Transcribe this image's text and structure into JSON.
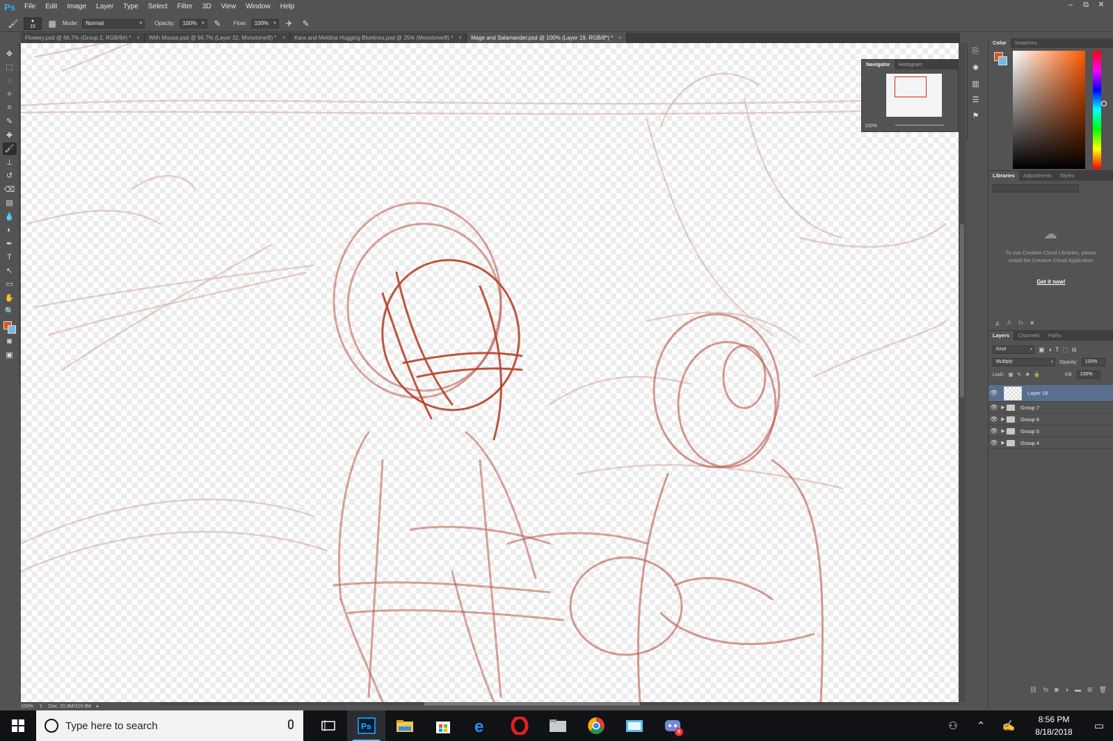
{
  "app": {
    "logo": "Ps",
    "menu": [
      "File",
      "Edit",
      "Image",
      "Layer",
      "Type",
      "Select",
      "Filter",
      "3D",
      "View",
      "Window",
      "Help"
    ],
    "window_controls": [
      "–",
      "⧉",
      "✕"
    ]
  },
  "options": {
    "brush_size": "15",
    "mode_label": "Mode:",
    "mode_value": "Normal",
    "opacity_label": "Opacity:",
    "opacity_value": "100%",
    "flow_label": "Flow:",
    "flow_value": "100%"
  },
  "tabs": [
    {
      "title": "Flowery.psd @ 66.7% (Group 2, RGB/8#) *",
      "active": false
    },
    {
      "title": "With Mouse.psd @ 66.7% (Layer 32, Monotone/8) *",
      "active": false
    },
    {
      "title": "Kara and Meldina Hugging Bluelines.psd @ 25% (Monotone/8) *",
      "active": false
    },
    {
      "title": "Mage and Salamander.psd @ 100% (Layer 19, RGB/8*) *",
      "active": true
    }
  ],
  "tools": [
    "move-tool",
    "marquee-tool",
    "lasso-tool",
    "quick-select-tool",
    "crop-tool",
    "eyedropper-tool",
    "healing-brush-tool",
    "brush-tool",
    "clone-stamp-tool",
    "history-brush-tool",
    "eraser-tool",
    "gradient-tool",
    "blur-tool",
    "dodge-tool",
    "pen-tool",
    "type-tool",
    "path-select-tool",
    "rectangle-tool",
    "hand-tool",
    "zoom-tool"
  ],
  "tool_glyphs": [
    "✥",
    "⬚",
    "◌",
    "✧",
    "⌗",
    "✎",
    "✚",
    "🖌",
    "⊥",
    "↺",
    "⌫",
    "▤",
    "💧",
    "◐",
    "✒",
    "T",
    "↖",
    "▭",
    "✋",
    "🔍"
  ],
  "colors": {
    "foreground": "#e1561f",
    "background": "#7ab7e6",
    "sketch_light": "#c98f86",
    "sketch_dark": "#b6432a"
  },
  "status": {
    "zoom": "100%",
    "doc": "Doc: 20.6M/319.9M"
  },
  "navigator": {
    "tabs": [
      "Navigator",
      "Histogram"
    ],
    "zoom": "100%"
  },
  "color_panel": {
    "tabs": [
      "Color",
      "Swatches"
    ]
  },
  "libraries": {
    "tabs": [
      "Libraries",
      "Adjustments",
      "Styles"
    ],
    "message": "To use Creative Cloud Libraries, please install the Creative Cloud Application",
    "link": "Get it now!"
  },
  "layers": {
    "tabs": [
      "Layers",
      "Channels",
      "Paths"
    ],
    "filter": "Kind",
    "blend_mode": "Multiply",
    "opacity_label": "Opacity:",
    "opacity_value": "100%",
    "lock_label": "Lock:",
    "fill_label": "Fill:",
    "fill_value": "100%",
    "items": [
      {
        "name": "Layer 19",
        "type": "layer",
        "selected": true
      },
      {
        "name": "Group 7",
        "type": "group",
        "selected": false
      },
      {
        "name": "Group 6",
        "type": "group",
        "selected": false
      },
      {
        "name": "Group 5",
        "type": "group",
        "selected": false
      },
      {
        "name": "Group 4",
        "type": "group",
        "selected": false
      }
    ]
  },
  "taskbar": {
    "search_placeholder": "Type here to search",
    "apps": [
      "task-view-icon",
      "photoshop-icon",
      "file-explorer-icon",
      "store-icon",
      "edge-icon",
      "opera-icon",
      "folder-icon",
      "chrome-icon",
      "photos-icon",
      "discord-icon"
    ],
    "discord_badge": "8",
    "time": "8:56 PM",
    "date": "8/18/2018"
  }
}
